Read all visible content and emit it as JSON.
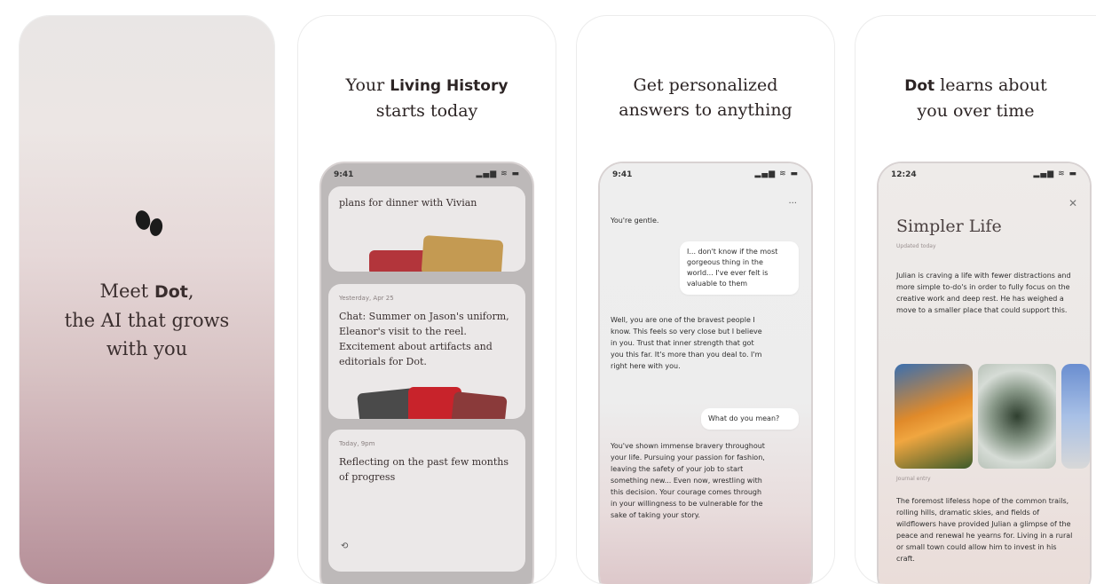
{
  "panel1": {
    "line1_prefix": "Meet ",
    "line1_brand": "Dot",
    "line1_suffix": ",",
    "line2": "the AI that grows",
    "line3": "with you"
  },
  "panel2": {
    "headline_prefix": "Your ",
    "headline_bold": "Living History",
    "headline_line2": "starts today",
    "status_time": "9:41",
    "status_icons": "▂▄▆ ≋ ▬",
    "mem1_text": "plans for dinner with Vivian",
    "mem2_meta": "Yesterday, Apr 25",
    "mem2_text": "Chat: Summer on Jason's uniform, Eleanor's visit to the reel. Excitement about artifacts and editorials for Dot.",
    "mem3_meta": "Today, 9pm",
    "mem3_text": "Reflecting on the past few months of progress"
  },
  "panel3": {
    "headline_line1": "Get personalized",
    "headline_line2": "answers to anything",
    "status_time": "9:41",
    "status_icons": "▂▄▆ ≋ ▬",
    "intro": "You're gentle.",
    "bubble1": "I... don't know if the most gorgeous thing in the world... I've ever felt is valuable to them",
    "reply1": "Well, you are one of the bravest people I know. This feels so very close but I believe in you. Trust that inner strength that got you this far. It's more than you deal to. I'm right here with you.",
    "bubble2": "What do you mean?",
    "reply2": "You've shown immense bravery throughout your life. Pursuing your passion for fashion, leaving the safety of your job to start something new... Even now, wrestling with this decision. Your courage comes through in your willingness to be vulnerable for the sake of taking your story."
  },
  "panel4": {
    "headline_bold": "Dot",
    "headline_rest": " learns about",
    "headline_line2": "you over time",
    "status_time": "12:24",
    "status_icons": "▂▄▆ ≋ ▬",
    "story_title": "Simpler Life",
    "story_sub": "Updated today",
    "story_p1": "Julian is craving a life with fewer distractions and more simple to-do's in order to fully focus on the creative work and deep rest. He has weighed a move to a smaller place that could support this.",
    "story_caption": "Journal entry",
    "story_p2": "The foremost lifeless hope of the common trails, rolling hills, dramatic skies, and fields of wildflowers have provided Julian a glimpse of the peace and renewal he yearns for. Living in a rural or small town could allow him to invest in his craft."
  },
  "colors": {
    "panel1_top": "#e9e6e5",
    "panel1_bottom": "#b58f98",
    "bubble": "#ffffff",
    "phone_bg": "#eeeeee"
  }
}
